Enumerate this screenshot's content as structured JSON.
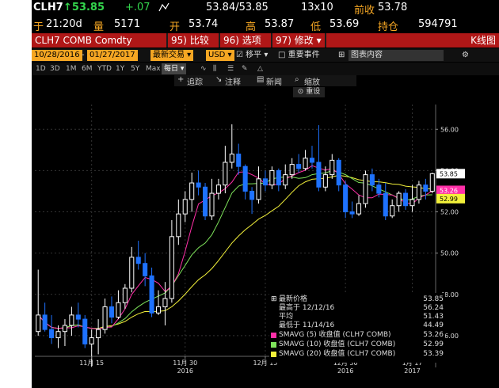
{
  "quote": {
    "ticker": "CLH7",
    "last": "↑53.85",
    "change": "+.07",
    "bid_ask": "53.84/53.85",
    "size": "13x10",
    "prev_close_label": "前收",
    "prev_close": "53.78",
    "time_label": "于",
    "time": "21:20d",
    "vol_label": "量",
    "volume": "5171",
    "open_label": "开",
    "open": "53.74",
    "high_label": "高",
    "high": "53.87",
    "low_label": "低",
    "low": "53.69",
    "oi_label": "持仓",
    "open_interest": "594791"
  },
  "cmdbar": {
    "security": "CLH7 COMB Comdty",
    "compare": "95) 比较",
    "options": "96) 选项 ▾",
    "edit": "97) 修改 ▾",
    "chart_type": "K线图"
  },
  "filters": {
    "start_date": "10/28/2016",
    "end_date": "01/27/2017",
    "mode": "最新交易 ▾",
    "currency": "USD ▾",
    "smooth_label": "☑ 移平 ▾",
    "events_label": "□ 重要事件",
    "table_label": "图表内容"
  },
  "tabs": [
    "1D",
    "3D",
    "1M",
    "6M",
    "YTD",
    "1Y",
    "5Y",
    "Max",
    "每日 ▾"
  ],
  "toolbar2": {
    "track": "追踪",
    "annotate": "注释",
    "news": "新闻",
    "zoom": "缩放",
    "reset": "重设"
  },
  "axis": {
    "y_ticks": [
      "56.00",
      "54.00",
      "52.00",
      "50.00",
      "48.00",
      "46.00"
    ],
    "x_ticks": [
      "11月 15",
      "11月 30",
      "12月 15",
      "12月 30",
      "1月 17"
    ],
    "x_years": [
      "2016",
      "2016",
      "2017"
    ],
    "last_tag": "53.85",
    "ma5_tag": "53.26",
    "ma20_tag": "52.99"
  },
  "legend": {
    "items": [
      {
        "label": "最新价格",
        "value": "53.85",
        "color": "#ffffff"
      },
      {
        "label": "最高于 12/12/16",
        "value": "56.24",
        "color": ""
      },
      {
        "label": "平均",
        "value": "51.43",
        "color": ""
      },
      {
        "label": "最低于 11/14/16",
        "value": "44.49",
        "color": ""
      },
      {
        "label": "SMAVG (5) 收盘值 (CLH7 COMB)",
        "value": "53.26",
        "color": "#ff2fa8"
      },
      {
        "label": "SMAVG (10) 收盘值 (CLH7 COMB)",
        "value": "52.99",
        "color": "#7ee35b"
      },
      {
        "label": "SMAVG (20) 收盘值 (CLH7 COMB)",
        "value": "53.39",
        "color": "#f2f03a"
      }
    ]
  },
  "colors": {
    "up": "#ffffff",
    "down": "#1e72ff",
    "ma5": "#ff2fa8",
    "ma10": "#7ee35b",
    "ma20": "#f2f03a"
  },
  "chart_data": {
    "type": "candlestick",
    "ylim": [
      45.0,
      57.2
    ],
    "ticks_y": [
      46,
      48,
      50,
      52,
      54,
      56
    ],
    "candles": [
      [
        46.2,
        47.0,
        49.2,
        46.0
      ],
      [
        47.0,
        46.3,
        47.6,
        46.2
      ],
      [
        46.3,
        45.9,
        47.0,
        45.6
      ],
      [
        45.9,
        46.2,
        46.5,
        45.4
      ],
      [
        46.2,
        46.5,
        46.8,
        45.5
      ],
      [
        46.5,
        47.0,
        47.4,
        46.0
      ],
      [
        47.0,
        46.8,
        47.6,
        46.4
      ],
      [
        46.8,
        45.6,
        47.0,
        45.4
      ],
      [
        45.6,
        45.9,
        46.3,
        44.49
      ],
      [
        45.9,
        46.3,
        46.8,
        45.1
      ],
      [
        46.3,
        47.4,
        47.8,
        46.1
      ],
      [
        47.4,
        46.9,
        47.9,
        46.6
      ],
      [
        46.9,
        47.6,
        48.2,
        46.8
      ],
      [
        47.6,
        48.3,
        48.5,
        47.3
      ],
      [
        48.3,
        49.8,
        50.3,
        48.1
      ],
      [
        49.8,
        49.5,
        50.6,
        49.2
      ],
      [
        49.5,
        48.9,
        50.0,
        48.4
      ],
      [
        48.9,
        47.1,
        49.3,
        46.9
      ],
      [
        47.1,
        47.4,
        48.2,
        47.0
      ],
      [
        47.4,
        47.8,
        48.6,
        46.5
      ],
      [
        47.8,
        50.8,
        51.6,
        47.6
      ],
      [
        50.8,
        51.9,
        52.6,
        50.4
      ],
      [
        51.9,
        52.6,
        53.0,
        51.5
      ],
      [
        52.6,
        53.4,
        53.9,
        52.0
      ],
      [
        53.4,
        53.2,
        54.0,
        52.8
      ],
      [
        53.2,
        51.8,
        53.4,
        51.6
      ],
      [
        51.8,
        52.9,
        53.6,
        51.6
      ],
      [
        52.9,
        53.3,
        53.6,
        52.6
      ],
      [
        53.3,
        54.4,
        55.2,
        52.9
      ],
      [
        54.4,
        54.8,
        56.24,
        54.1
      ],
      [
        54.8,
        54.2,
        55.3,
        53.8
      ],
      [
        54.2,
        53.0,
        54.3,
        52.6
      ],
      [
        53.0,
        52.6,
        53.2,
        51.9
      ],
      [
        52.6,
        53.6,
        54.2,
        52.4
      ],
      [
        53.6,
        53.3,
        54.0,
        53.0
      ],
      [
        53.3,
        54.0,
        54.2,
        53.1
      ],
      [
        54.0,
        53.3,
        54.1,
        53.0
      ],
      [
        53.3,
        53.8,
        54.3,
        53.1
      ],
      [
        53.8,
        54.3,
        54.6,
        53.6
      ],
      [
        54.3,
        54.1,
        54.8,
        53.9
      ],
      [
        54.1,
        54.6,
        55.0,
        54.0
      ],
      [
        54.6,
        54.4,
        55.2,
        54.1
      ],
      [
        54.4,
        53.2,
        56.2,
        53.0
      ],
      [
        53.2,
        53.8,
        54.2,
        53.0
      ],
      [
        53.8,
        54.5,
        54.8,
        53.6
      ],
      [
        54.5,
        53.3,
        54.6,
        53.0
      ],
      [
        53.3,
        52.0,
        53.5,
        51.7
      ],
      [
        52.0,
        51.9,
        52.5,
        51.7
      ],
      [
        51.9,
        52.4,
        52.8,
        51.8
      ],
      [
        52.4,
        53.8,
        54.0,
        52.2
      ],
      [
        53.8,
        53.3,
        54.1,
        53.0
      ],
      [
        53.3,
        52.9,
        53.6,
        52.7
      ],
      [
        52.9,
        51.8,
        53.4,
        51.6
      ],
      [
        51.8,
        52.3,
        52.6,
        51.7
      ],
      [
        52.3,
        52.9,
        53.0,
        52.0
      ],
      [
        52.9,
        52.3,
        53.1,
        52.1
      ],
      [
        52.3,
        52.6,
        53.3,
        52.0
      ],
      [
        52.6,
        53.3,
        53.5,
        52.4
      ],
      [
        53.3,
        53.0,
        53.6,
        52.6
      ],
      [
        53.0,
        53.85,
        53.9,
        52.9
      ]
    ],
    "last": 53.85,
    "high": 56.24,
    "average": 51.43,
    "low": 44.49,
    "ma5_last": 53.26,
    "ma10_last": 52.99,
    "ma20_last": 53.39
  }
}
